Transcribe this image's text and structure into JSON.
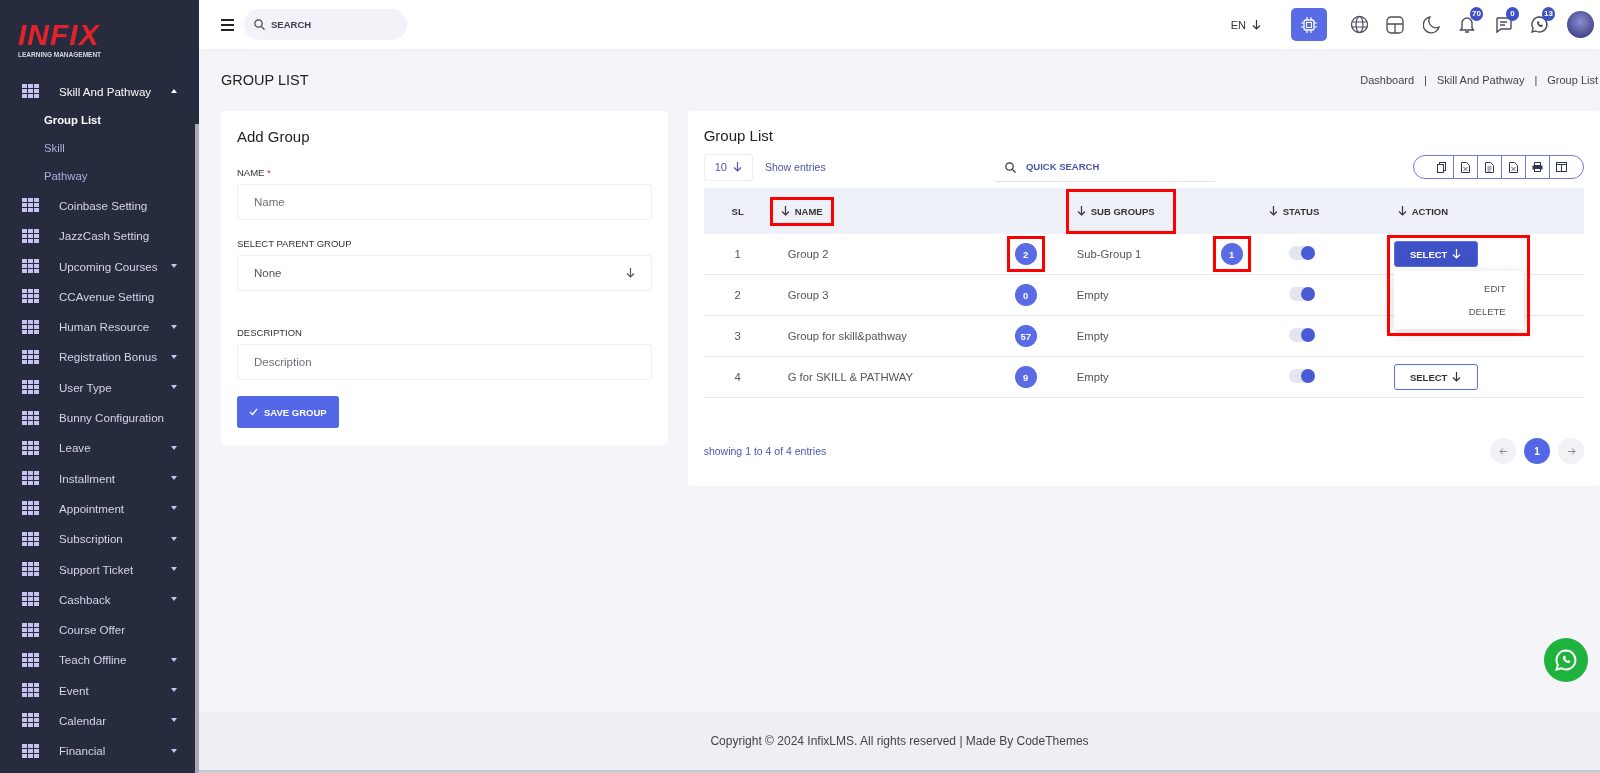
{
  "logo": {
    "brand": "INFIX",
    "tagline": "LEARNING MANAGEMENT"
  },
  "sidebar": {
    "items": [
      {
        "label": "Skill And Pathway",
        "expandable": true,
        "expanded": true,
        "children": [
          {
            "label": "Group List",
            "selected": true
          },
          {
            "label": "Skill",
            "selected": false
          },
          {
            "label": "Pathway",
            "selected": false
          }
        ]
      },
      {
        "label": "Coinbase Setting",
        "expandable": false,
        "expanded": false
      },
      {
        "label": "JazzCash Setting",
        "expandable": false,
        "expanded": false
      },
      {
        "label": "Upcoming Courses",
        "expandable": true,
        "expanded": false
      },
      {
        "label": "CCAvenue Setting",
        "expandable": false,
        "expanded": false
      },
      {
        "label": "Human Resource",
        "expandable": true,
        "expanded": false
      },
      {
        "label": "Registration Bonus",
        "expandable": true,
        "expanded": false
      },
      {
        "label": "User Type",
        "expandable": true,
        "expanded": false
      },
      {
        "label": "Bunny Configuration",
        "expandable": false,
        "expanded": false
      },
      {
        "label": "Leave",
        "expandable": true,
        "expanded": false
      },
      {
        "label": "Installment",
        "expandable": true,
        "expanded": false
      },
      {
        "label": "Appointment",
        "expandable": true,
        "expanded": false
      },
      {
        "label": "Subscription",
        "expandable": true,
        "expanded": false
      },
      {
        "label": "Support Ticket",
        "expandable": true,
        "expanded": false
      },
      {
        "label": "Cashback",
        "expandable": true,
        "expanded": false
      },
      {
        "label": "Course Offer",
        "expandable": false,
        "expanded": false
      },
      {
        "label": "Teach Offline",
        "expandable": true,
        "expanded": false
      },
      {
        "label": "Event",
        "expandable": true,
        "expanded": false
      },
      {
        "label": "Calendar",
        "expandable": true,
        "expanded": false
      },
      {
        "label": "Financial",
        "expandable": true,
        "expanded": false
      }
    ]
  },
  "topbar": {
    "search": {
      "placeholder": "SEARCH"
    },
    "language": "EN",
    "badges": [
      {
        "kind": "bell",
        "count": "70"
      },
      {
        "kind": "chat",
        "count": "0"
      },
      {
        "kind": "whatsapp",
        "count": "13"
      }
    ]
  },
  "page": {
    "title": "GROUP LIST",
    "breadcrumb": [
      "Dashboard",
      "Skill And Pathway",
      "Group List"
    ],
    "breadcrumb_separator": "|"
  },
  "form": {
    "title": "Add Group",
    "fields": [
      {
        "label": "NAME",
        "required": true,
        "kind": "text",
        "placeholder": "Name"
      },
      {
        "label": "SELECT PARENT GROUP",
        "required": false,
        "kind": "select",
        "value": "None"
      },
      {
        "label": "DESCRIPTION",
        "required": false,
        "kind": "text",
        "placeholder": "Description"
      }
    ],
    "required_mark": "*",
    "submit": "SAVE GROUP"
  },
  "list": {
    "title": "Group List",
    "page_size": "10",
    "show_entries": "Show entries",
    "quick_search": {
      "placeholder": "QUICK SEARCH"
    },
    "export_tools": [
      {
        "kind": "copy"
      },
      {
        "kind": "excel"
      },
      {
        "kind": "csv"
      },
      {
        "kind": "pdf"
      },
      {
        "kind": "print"
      },
      {
        "kind": "columns"
      }
    ],
    "columns": [
      {
        "label": "SL",
        "sortable": false,
        "highlighted": false
      },
      {
        "label": "NAME",
        "sortable": true,
        "highlighted": true
      },
      {
        "label": "SUB GROUPS",
        "sortable": true,
        "highlighted": true
      },
      {
        "label": "STATUS",
        "sortable": true,
        "highlighted": false
      },
      {
        "label": "ACTION",
        "sortable": true,
        "highlighted": false
      }
    ],
    "rows": [
      {
        "sl": "1",
        "name": "Group 2",
        "count": "2",
        "count_highlighted": true,
        "sub_group": "Sub-Group 1",
        "sub_count": "1",
        "sub_count_highlighted": true,
        "status_on": true,
        "action": {
          "label": "SELECT",
          "open": true,
          "highlighted": true,
          "menu": [
            "EDIT",
            "DELETE"
          ]
        }
      },
      {
        "sl": "2",
        "name": "Group 3",
        "count": "0",
        "count_highlighted": false,
        "sub_group": "Empty",
        "status_on": true
      },
      {
        "sl": "3",
        "name": "Group for skill&pathway",
        "count": "57",
        "count_highlighted": false,
        "sub_group": "Empty",
        "status_on": true
      },
      {
        "sl": "4",
        "name": "G for SKILL & PATHWAY",
        "count": "9",
        "count_highlighted": false,
        "sub_group": "Empty",
        "status_on": true,
        "action": {
          "label": "SELECT",
          "open": false,
          "highlighted": false
        }
      }
    ],
    "summary": "showing 1 to 4 of 4 entries",
    "pages": [
      {
        "label": "1",
        "selected": true
      }
    ]
  },
  "footer": "Copyright © 2024 InfixLMS. All rights reserved | Made By CodeThemes"
}
